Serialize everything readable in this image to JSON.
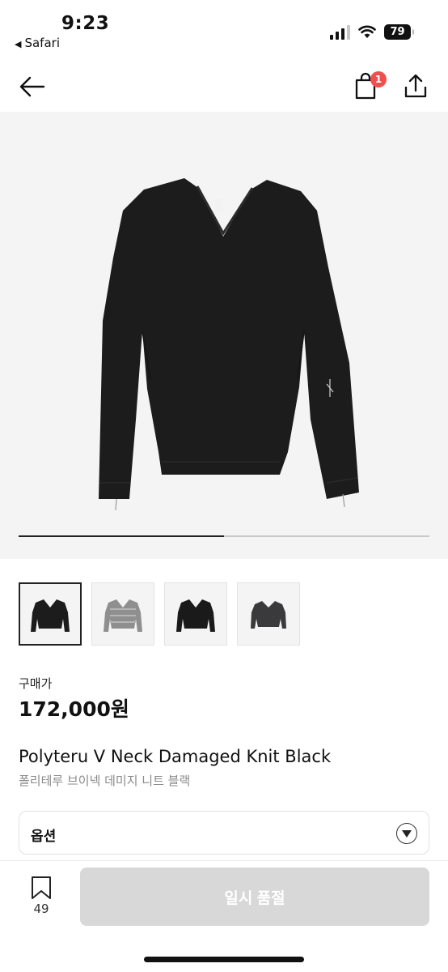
{
  "status_bar": {
    "time": "9:23",
    "back_app": "Safari",
    "battery": "79",
    "icons": [
      "cellular-signal-icon",
      "wifi-icon",
      "battery-icon"
    ]
  },
  "nav": {
    "icons": [
      "arrow-left-icon",
      "shopping-bag-icon",
      "share-icon"
    ],
    "cart_count": "1"
  },
  "gallery": {
    "progress": 0.5,
    "thumbnails": [
      {
        "name": "black-front",
        "selected": true
      },
      {
        "name": "grey-front",
        "selected": false
      },
      {
        "name": "black-front-2",
        "selected": false
      },
      {
        "name": "charcoal-front",
        "selected": false
      }
    ]
  },
  "product": {
    "price_label": "구매가",
    "price": "172,000원",
    "name": "Polyteru V Neck Damaged Knit Black",
    "name_ko": "폴리테루 브이넥 데미지 니트 블랙"
  },
  "option": {
    "label": "옵션",
    "icon": "chevron-down-circle-icon"
  },
  "bottom": {
    "bookmark_count": "49",
    "button_label": "일시 품절"
  },
  "colors": {
    "badge": "#f0504d",
    "disabled_button": "#d8d8d8",
    "hero_background": "#f4f4f4"
  }
}
